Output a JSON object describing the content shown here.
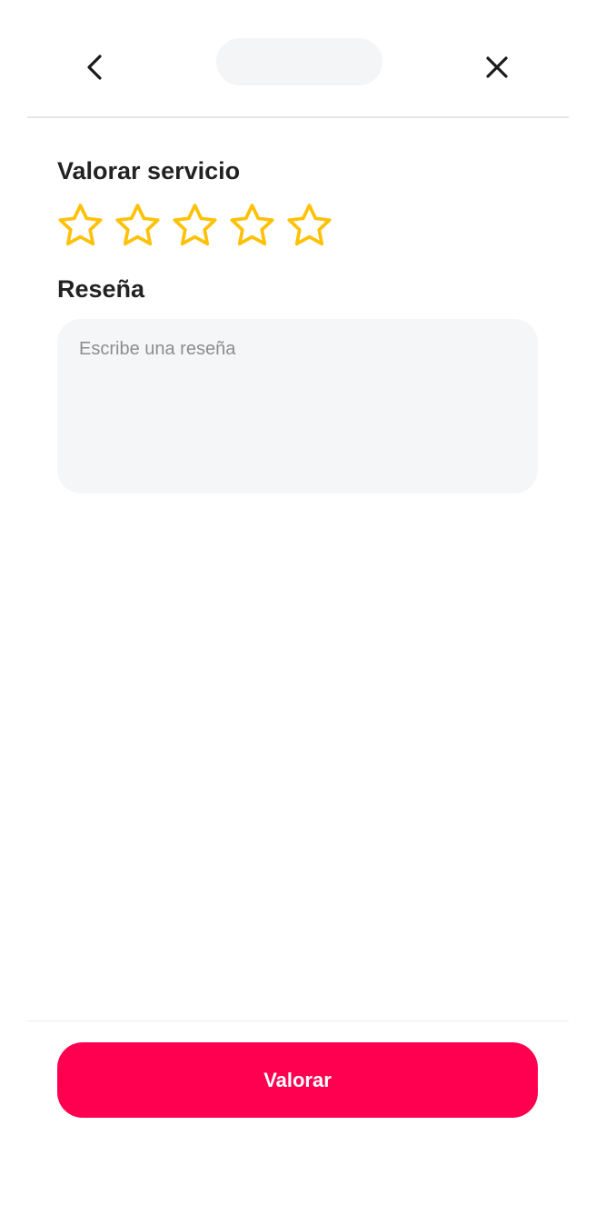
{
  "header": {
    "back_icon": "chevron-left-icon",
    "close_icon": "close-icon",
    "title": ""
  },
  "rating": {
    "title": "Valorar servicio",
    "max_stars": 5,
    "selected": 0,
    "star_color": "#FFC107"
  },
  "review": {
    "title": "Reseña",
    "value": "",
    "placeholder": "Escribe una reseña"
  },
  "footer": {
    "submit_label": "Valorar",
    "submit_color": "#FF0050"
  }
}
